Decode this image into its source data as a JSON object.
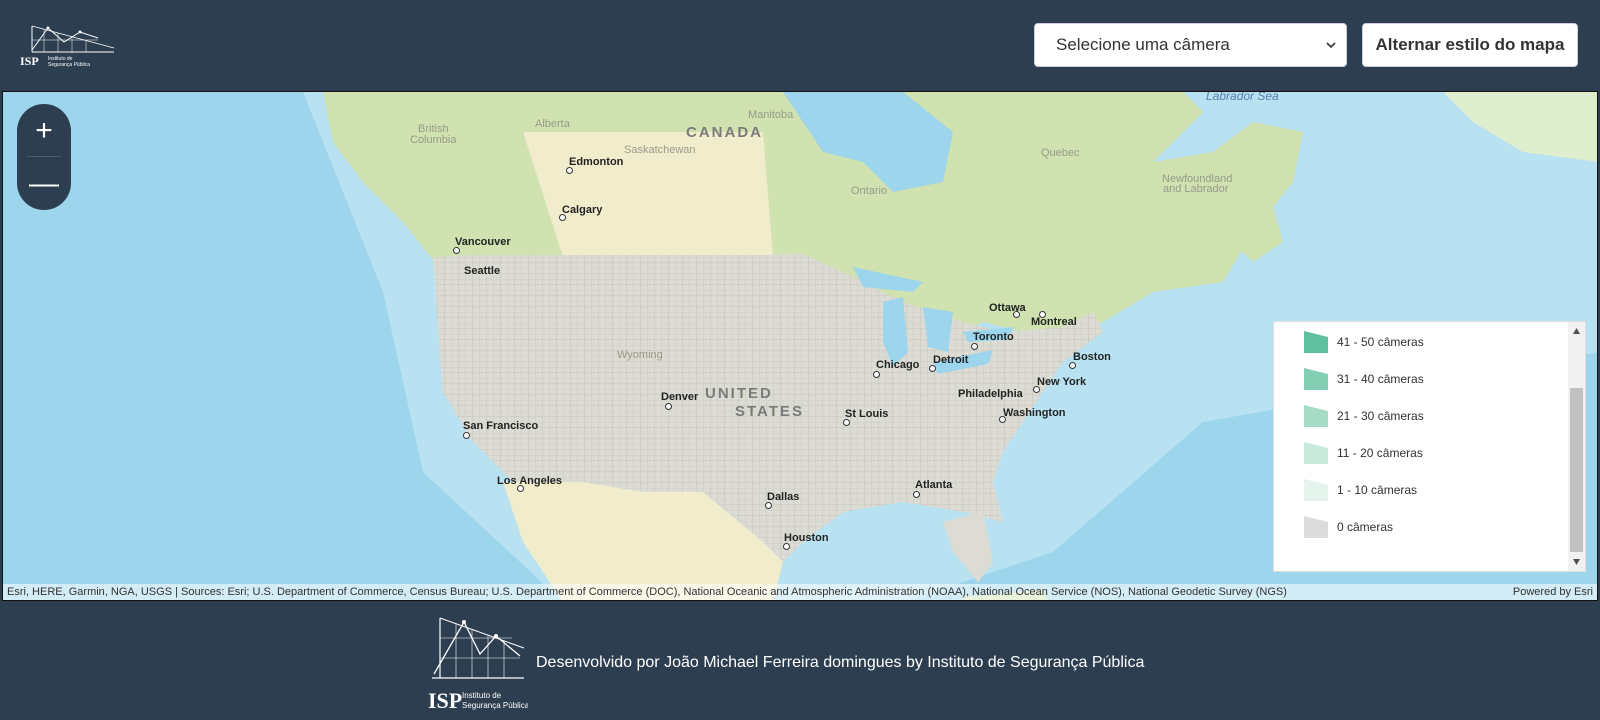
{
  "header": {
    "logo_text": "ISP",
    "logo_subtitle_1": "Instituto de",
    "logo_subtitle_2": "Segurança Pública",
    "camera_select_value": "Selecione uma câmera",
    "toggle_map_style_label": "Alternar estilo do mapa"
  },
  "map": {
    "zoom_in_glyph": "+",
    "zoom_out_glyph": "—",
    "attribution": "Esri, HERE, Garmin, NGA, USGS | Sources: Esri; U.S. Department of Commerce, Census Bureau; U.S. Department of Commerce (DOC), National Oceanic and Atmospheric Administration (NOAA), National Ocean Service (NOS), National Geodetic Survey (NGS)",
    "powered_by": "Powered by Esri",
    "labels": {
      "canada": "CANADA",
      "united_states_1": "UNITED",
      "united_states_2": "STATES",
      "british_columbia_1": "British",
      "british_columbia_2": "Columbia",
      "alberta": "Alberta",
      "saskatchewan": "Saskatchewan",
      "manitoba": "Manitoba",
      "ontario": "Ontario",
      "quebec": "Quebec",
      "newfoundland_1": "Newfoundland",
      "newfoundland_2": "and Labrador",
      "labrador_sea": "Labrador Sea",
      "wyoming": "Wyoming",
      "edmonton": "Edmonton",
      "calgary": "Calgary",
      "vancouver": "Vancouver",
      "seattle": "Seattle",
      "ottawa": "Ottawa",
      "montreal": "Montreal",
      "toronto": "Toronto",
      "boston": "Boston",
      "chicago": "Chicago",
      "detroit": "Detroit",
      "new_york": "New York",
      "philadelphia": "Philadelphia",
      "washington": "Washington",
      "denver": "Denver",
      "st_louis": "St Louis",
      "san_francisco": "San Francisco",
      "los_angeles": "Los Angeles",
      "dallas": "Dallas",
      "atlanta": "Atlanta",
      "houston": "Houston"
    }
  },
  "legend": {
    "items": [
      {
        "label": "41 - 50 câmeras",
        "color": "#5fbf9f"
      },
      {
        "label": "31 - 40 câmeras",
        "color": "#83cdb2"
      },
      {
        "label": "21 - 30 câmeras",
        "color": "#a6dbc6"
      },
      {
        "label": "11 - 20 câmeras",
        "color": "#c8e9dc"
      },
      {
        "label": "1 - 10 câmeras",
        "color": "#e6f4ee"
      },
      {
        "label": "0 câmeras",
        "color": "#dcdcdc"
      }
    ]
  },
  "footer": {
    "credit_text": "Desenvolvido por João Michael Ferreira domingues by Instituto de Segurança Pública",
    "logo_text": "ISP",
    "logo_subtitle_1": "Instituto de",
    "logo_subtitle_2": "Segurança Pública"
  }
}
